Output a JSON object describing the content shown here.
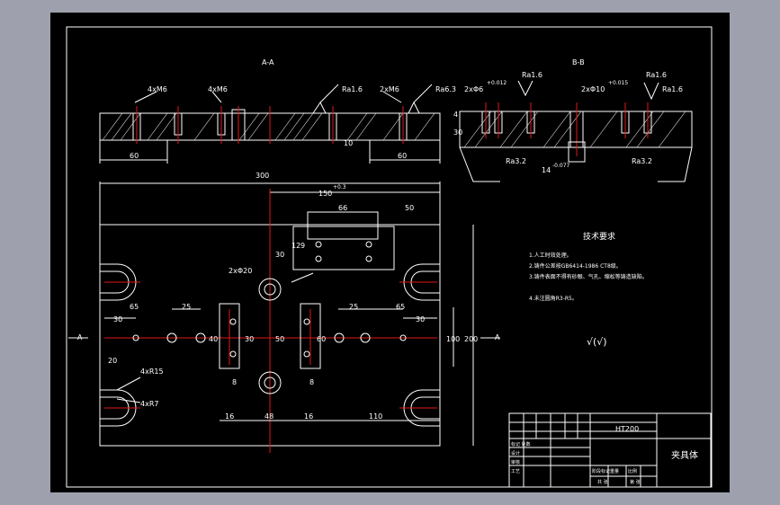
{
  "views": {
    "section_aa": {
      "title": "A-A"
    },
    "section_bb": {
      "title": "B-B"
    }
  },
  "section_aa_labels": {
    "hole_left": "4xM6",
    "hole_mid": "4xM6",
    "hole_right": "2xM6",
    "ra_mid": "Ra1.6",
    "ra_right": "Ra6.3",
    "dim_left": "60",
    "dim_right": "60",
    "dim_depth": "10"
  },
  "section_bb_labels": {
    "holes_left": "2xΦ6",
    "tol_left": "+0.012",
    "ra_top_left": "Ra1.6",
    "holes_right": "2xΦ10",
    "tol_right": "+0.015",
    "ra_top_right_1": "Ra1.6",
    "ra_top_right_2": "Ra1.6",
    "dim_height": "30",
    "dim_small": "4",
    "slot": "14",
    "slot_tol": "-0.077",
    "ra_bottom_left": "Ra3.2",
    "ra_bottom_right": "Ra3.2"
  },
  "plan_dims": {
    "overall_width": "300",
    "d150": "150",
    "d150_tol": "+0.3",
    "d66": "66",
    "d50": "50",
    "d12": "12",
    "d9": "9",
    "d30_top": "30",
    "hole_2x20": "2xΦ20",
    "d65_left": "65",
    "d25_left": "25",
    "d30_left": "30",
    "d40": "40",
    "d30_center": "30",
    "d8_left": "8",
    "d50_center": "50",
    "d60": "60",
    "d8_right": "8",
    "d25_right": "25",
    "d65_right": "65",
    "d30_right": "30",
    "d100": "100",
    "d200": "200",
    "d20": "20",
    "hole_4xr15": "4xR15",
    "hole_4xr7": "4xR7",
    "d16_left": "16",
    "d48": "48",
    "d16_right": "16",
    "d110": "110",
    "section_mark_left": "A",
    "section_mark_right": "A"
  },
  "technical_requirements": {
    "heading": "技术要求",
    "items": [
      "1.人工时效处理。",
      "2.铸件公差按GB6414-1986 CT8级。",
      "3.铸件表面不得有砂眼、气孔、缩松等铸造缺陷。",
      "4.未注圆角R3-R5。"
    ],
    "roughness_symbol": "√(√)"
  },
  "title_block": {
    "material": "HT200",
    "part_name": "夹具体",
    "rows": [
      "标记 处数",
      "设计",
      "审核",
      "工艺"
    ],
    "footer": [
      "阶段标记",
      "重量",
      "比例",
      "共 张",
      "第 张"
    ]
  }
}
